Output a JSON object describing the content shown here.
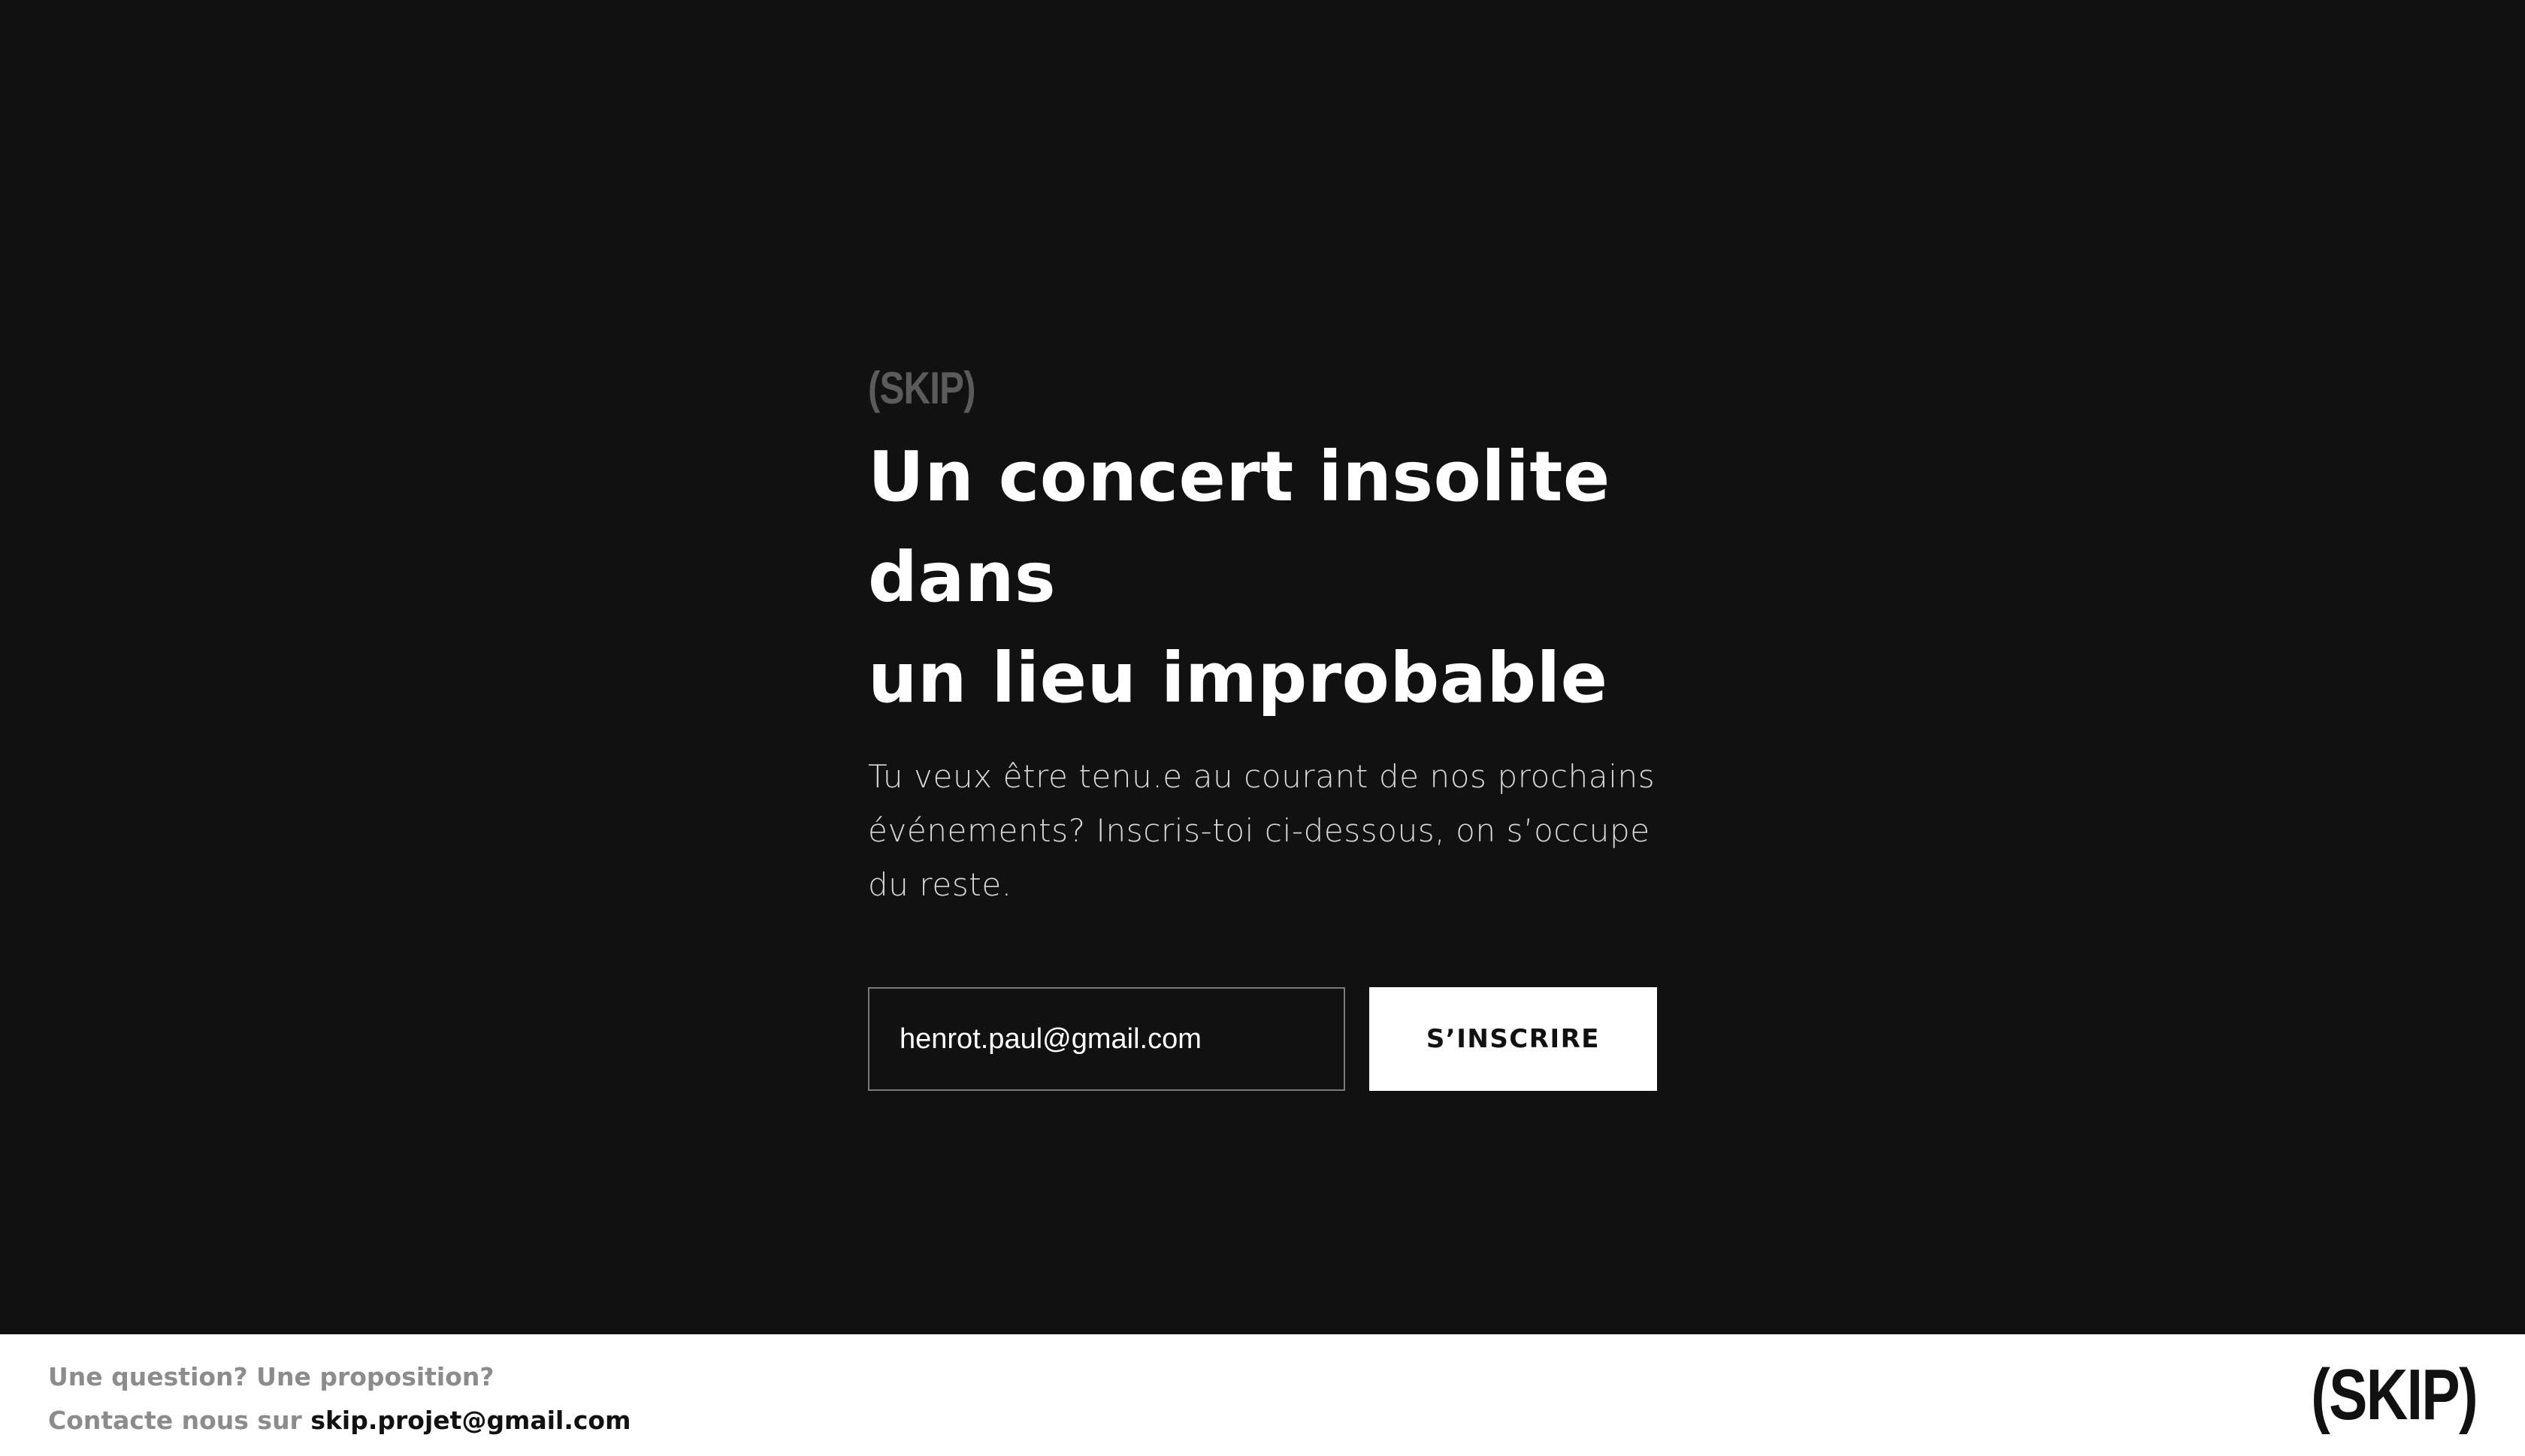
{
  "brand": {
    "eyebrow": "(SKIP)",
    "footer_logo": "(SKIP)"
  },
  "hero": {
    "headline_line1": "Un concert insolite dans",
    "headline_line2": "un lieu improbable",
    "description": "Tu veux être tenu.e au courant de nos prochains événements? Inscris-toi ci-dessous, on s’occupe du reste."
  },
  "signup": {
    "email_value": "henrot.paul@gmail.com",
    "submit_label": "S’INSCRIRE"
  },
  "footer": {
    "line1": "Une question? Une proposition?",
    "line2_prefix": "Contacte nous sur",
    "email": "skip.projet@gmail.com"
  },
  "colors": {
    "background": "#111111",
    "footer_background": "#ffffff",
    "muted": "#5b5b5b",
    "footer_muted": "#8c8c8c"
  }
}
